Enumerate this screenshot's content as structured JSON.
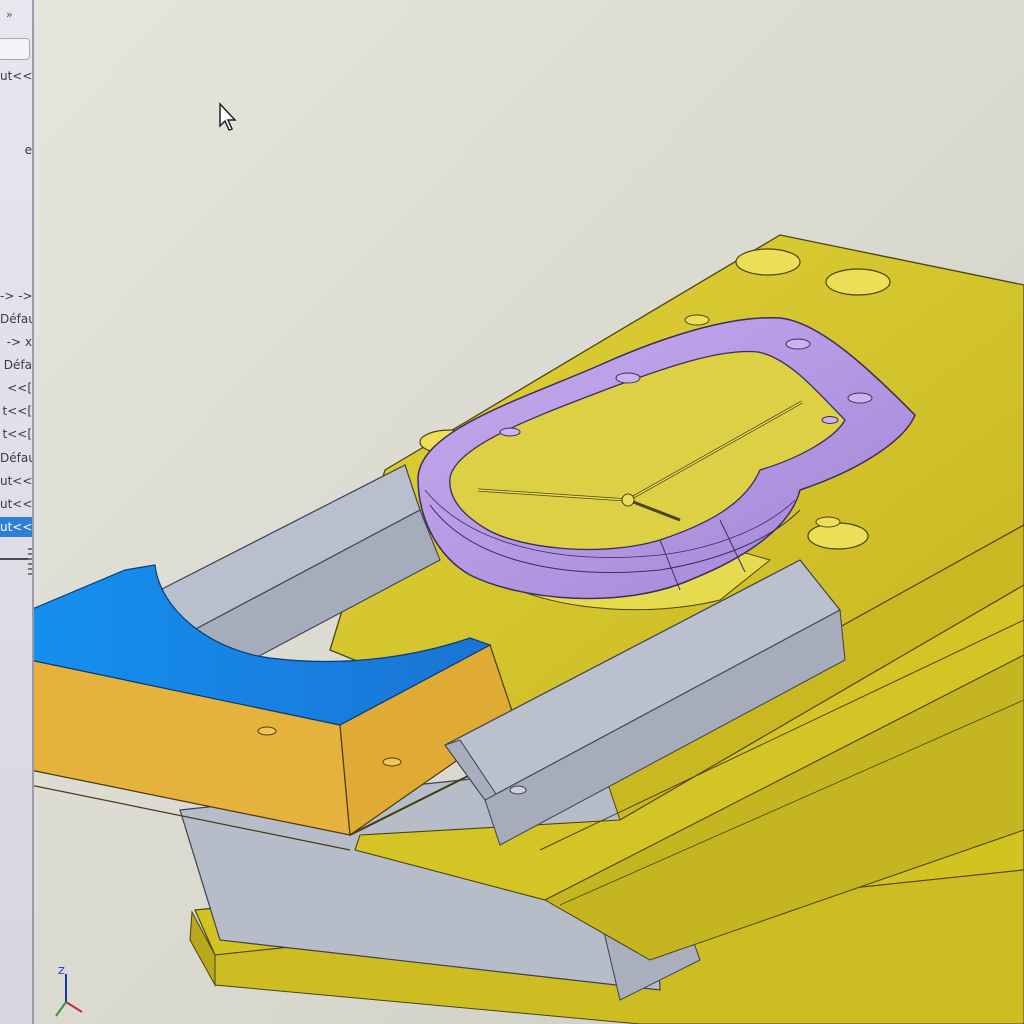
{
  "toolbar": {
    "expand_glyph": "»"
  },
  "tree": {
    "items": [
      {
        "label": "ut<<",
        "selected": false
      },
      {
        "label": "e",
        "selected": false
      },
      {
        "label": "-> ->",
        "selected": false
      },
      {
        "label": "Défau",
        "selected": false
      },
      {
        "label": "-> x",
        "selected": false
      },
      {
        "label": "Défa",
        "selected": false
      },
      {
        "label": "<<[",
        "selected": false
      },
      {
        "label": "t<<[",
        "selected": false
      },
      {
        "label": "t<<[",
        "selected": false
      },
      {
        "label": "Défau",
        "selected": false
      },
      {
        "label": "ut<<",
        "selected": false
      },
      {
        "label": "ut<<[",
        "selected": false
      },
      {
        "label": "ut<<",
        "selected": true
      }
    ]
  },
  "triad": {
    "z_label": "Z"
  },
  "colors": {
    "base_plate": "#d6c62a",
    "cavity_ring": "#b79be4",
    "slider_top": "#1e86e6",
    "slider_side": "#e4b23c",
    "guide_rail": "#b9bfcd",
    "selection": "#2e7fd8"
  },
  "icons": [
    "chevron-right-icon",
    "mouse-cursor-icon",
    "axis-triad-icon"
  ]
}
